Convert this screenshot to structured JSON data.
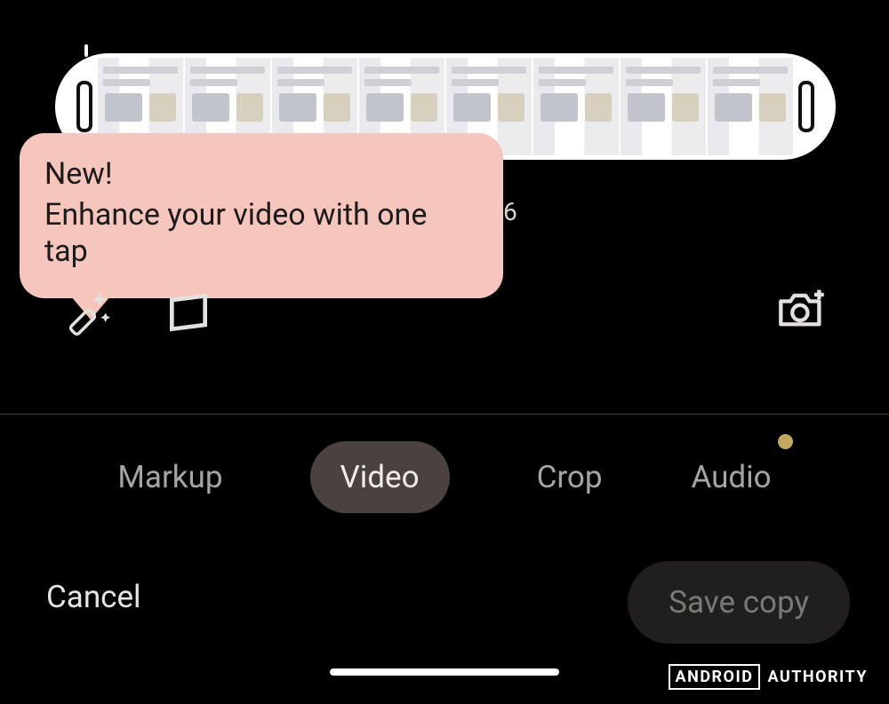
{
  "tooltip": {
    "title": "New!",
    "body": "Enhance your video with one tap"
  },
  "behind_fragment": "6",
  "tabs": {
    "items": [
      "Markup",
      "Video",
      "Crop",
      "Audio"
    ],
    "active_index": 1,
    "audio_has_indicator": true
  },
  "actions": {
    "cancel": "Cancel",
    "save": "Save copy"
  },
  "tools": {
    "enhance": "enhance-wand-icon",
    "export_frame": "export-frame-icon",
    "camera": "camera-plus-icon"
  },
  "watermark": {
    "boxed": "ANDROID",
    "plain": "AUTHORITY"
  }
}
